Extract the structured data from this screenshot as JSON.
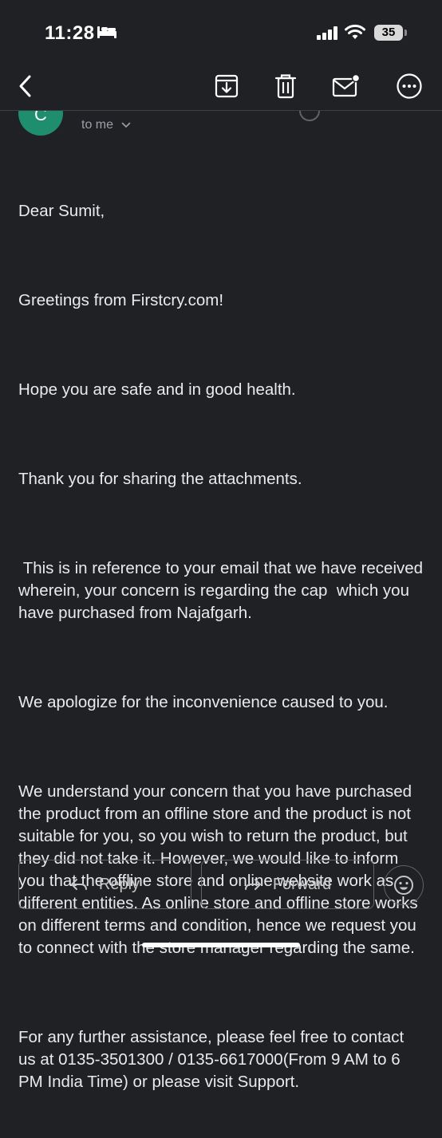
{
  "status_bar": {
    "time": "11:28",
    "battery": "35"
  },
  "email": {
    "sender_initial": "C",
    "recipient_label": "to me",
    "paragraphs": [
      "Dear Sumit,",
      "Greetings from Firstcry.com!",
      "Hope you are safe and in good health.",
      "Thank you for sharing the attachments.",
      " This is in reference to your email that we have received wherein, your concern is regarding the cap  which you have purchased from Najafgarh.",
      "We apologize for the inconvenience caused to you.",
      "We understand your concern that you have purchased the product from an offline store and the product is not suitable for you, so you wish to return the product, but they did not take it. However, we would like to inform you that the offline store and online website work as different entities. As online store and offline store works on different terms and condition, hence we request you to connect with the store manager regarding the same.",
      "For any further assistance, please feel free to contact us at 0135-3501300 / 0135-6617000(From 9 AM to 6 PM India Time) or please visit Support."
    ]
  },
  "actions": {
    "reply_label": "Reply",
    "forward_label": "Forward"
  },
  "icons": {
    "back": "chevron-left-icon",
    "archive": "archive-icon",
    "delete": "trash-icon",
    "mark_unread": "mail-unread-icon",
    "more": "more-horizontal-icon",
    "emoji": "emoji-smile-icon"
  }
}
